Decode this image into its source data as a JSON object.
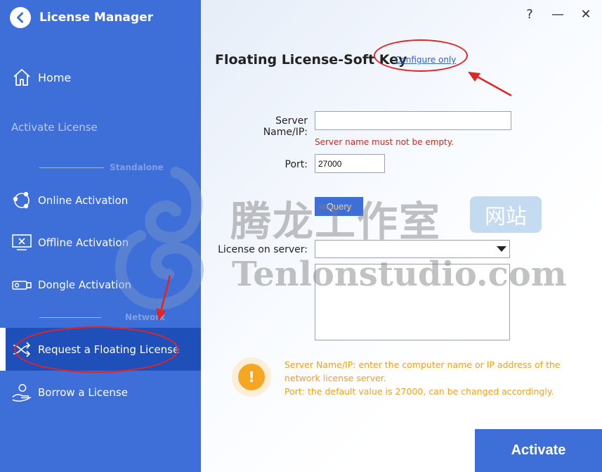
{
  "app": {
    "title": "License Manager"
  },
  "window_controls": {
    "help": "?",
    "minimize": "—",
    "close": "✕"
  },
  "sidebar": {
    "home": "Home",
    "section_activate": "Activate License",
    "group_standalone": "Standalone",
    "group_network": "Network",
    "items": [
      {
        "label": "Online Activation",
        "icon": "share-nodes-icon"
      },
      {
        "label": "Offline Activation",
        "icon": "monitor-icon"
      },
      {
        "label": "Dongle Activation",
        "icon": "usb-dongle-icon"
      },
      {
        "label": "Request a Floating License",
        "icon": "shuffle-icon",
        "active": true
      },
      {
        "label": "Borrow a License",
        "icon": "hand-license-icon"
      }
    ]
  },
  "main": {
    "title": "Floating License-Soft Key",
    "configure_link": "Configure only",
    "server_label": "Server Name/IP:",
    "server_value": "",
    "server_error": "Server name must not be empty.",
    "port_label": "Port:",
    "port_value": "27000",
    "query_label": "Query",
    "license_label": "License on server:",
    "license_selected": "",
    "info_line1": "Server Name/IP: enter the computer name or IP address of the network license server.",
    "info_line2": "Port: the default value is 27000, can be changed accordingly.",
    "activate_label": "Activate"
  },
  "watermark": {
    "cn": "腾龙工作室",
    "badge": "网站",
    "en": "Tenlonstudio.com"
  },
  "colors": {
    "sidebar": "#3e6fd9",
    "active": "#1f4fb8",
    "error": "#d62626",
    "info": "#f0a023",
    "annotation": "#e42323"
  }
}
